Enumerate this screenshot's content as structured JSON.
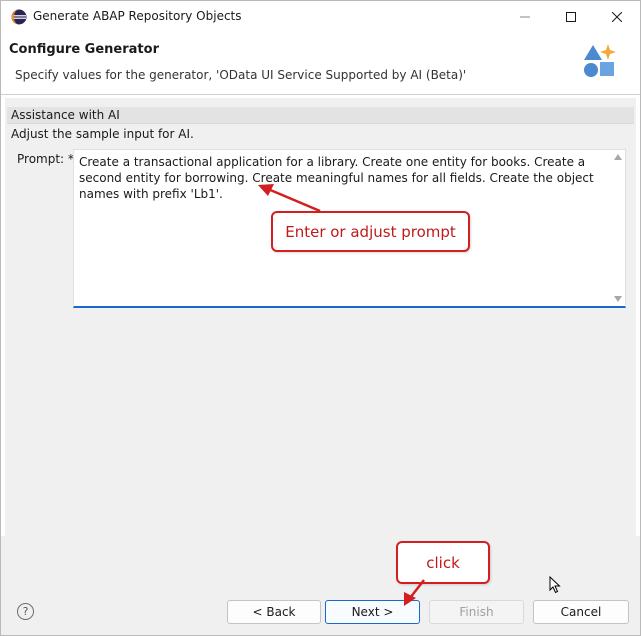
{
  "window": {
    "title": "Generate ABAP Repository Objects"
  },
  "header": {
    "title": "Configure Generator",
    "description": "Specify values for the generator, 'OData UI Service Supported by AI (Beta)'"
  },
  "section": {
    "title": "Assistance with AI",
    "subtitle": "Adjust the sample input for AI."
  },
  "prompt": {
    "label": "Prompt: *",
    "value": "Create a transactional application for a library. Create one entity for books. Create a second entity for borrowing. Create meaningful names for all fields. Create the object names with prefix 'Lb1'."
  },
  "annotations": {
    "prompt_callout": "Enter or adjust prompt",
    "click_callout": "click"
  },
  "footer": {
    "help_icon": "?",
    "back_label": "< Back",
    "next_label": "Next >",
    "finish_label": "Finish",
    "cancel_label": "Cancel"
  },
  "colors": {
    "accent_blue": "#1b6ac9",
    "callout_red": "#d31f1f"
  },
  "icons": {
    "app": "eclipse-icon",
    "header": "generator-shapes-icon",
    "help": "help-icon"
  }
}
